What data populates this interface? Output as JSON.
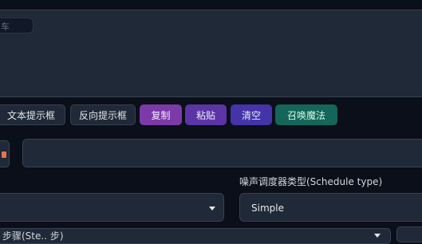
{
  "prompt_area": {
    "tag_text": "车"
  },
  "toolbar": {
    "buttons": [
      {
        "label": "文本提示框"
      },
      {
        "label": "反向提示框"
      },
      {
        "label": "复制"
      },
      {
        "label": "粘贴"
      },
      {
        "label": "清空"
      },
      {
        "label": "召唤魔法"
      }
    ]
  },
  "schedule": {
    "label": "噪声调度器类型(Schedule type)",
    "selected": "Simple"
  },
  "bottom": {
    "label": "步骤(Ste.. 步)"
  }
}
